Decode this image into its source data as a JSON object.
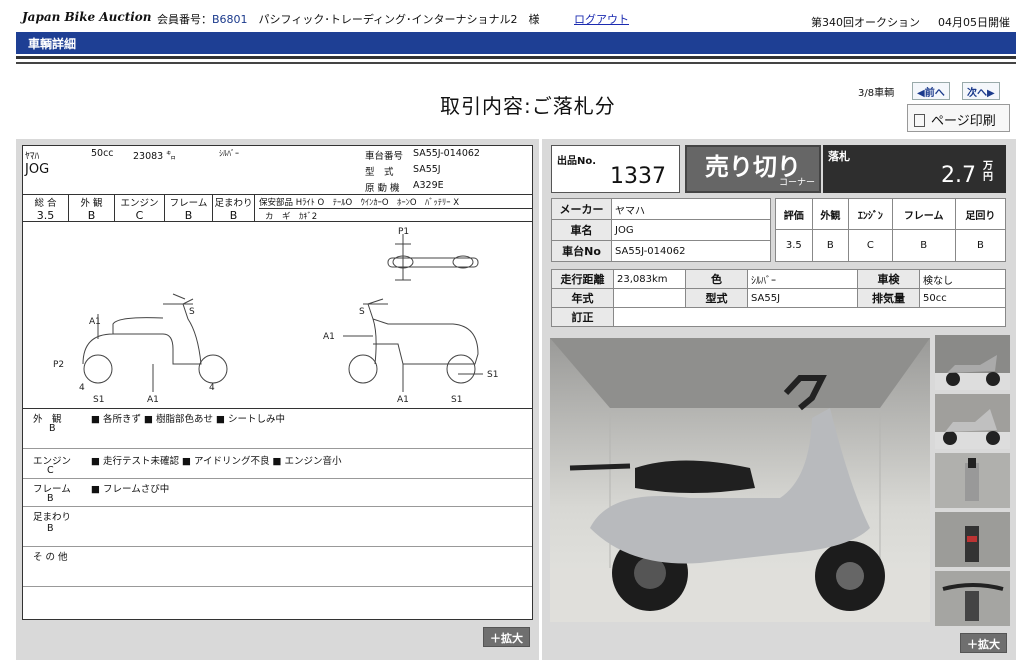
{
  "header": {
    "logo": "Japan Bike Auction",
    "member_label": "会員番号：",
    "member_no": "B6801",
    "member_name": "パシフィック･トレーディング･インターナショナル2　様",
    "logout": "ログアウト",
    "auction": "第340回オークション",
    "date": "04月05日開催"
  },
  "title_bar": "車輌詳細",
  "page_heading": "取引内容:ご落札分",
  "nav": {
    "count": "3/8車輌",
    "prev": "◀前へ",
    "next": "次へ▶",
    "print": "ページ印刷"
  },
  "sheet": {
    "maker": "ﾔﾏﾊ",
    "cc": "50cc",
    "km": "23083 ㌔",
    "color": "ｼﾙﾊﾞｰ",
    "model": "JOG",
    "frame_label": "車台番号",
    "frame_no": "SA55J-014062",
    "type_label": "型　式",
    "type": "SA55J",
    "engine_label": "原 動 機",
    "engine": "A329E",
    "grade_headers": [
      "総 合",
      "外 観",
      "エンジン",
      "フレーム",
      "足まわり"
    ],
    "grade_values": [
      "3.5",
      "B",
      "C",
      "B",
      "B"
    ],
    "parts_header": "保安部品 Hﾗｲﾄ O　ﾃｰﾙO　ｳｲﾝｶｰO　ﾎｰﾝO　ﾊﾞｯﾃﾘｰ X",
    "parts_key": "カ　ギ　ｶｷﾞ2",
    "diagram_labels": {
      "p1": "P1",
      "p2": "P2",
      "a1": "A1",
      "s": "S",
      "s1": "S1",
      "four": "4"
    },
    "remarks": [
      {
        "label": "外　観",
        "grade": "B",
        "text": "■ 各所きず ■ 樹脂部色あせ ■ シートしみ中"
      },
      {
        "label": "エンジン",
        "grade": "C",
        "text": "■ 走行テスト未確認 ■ アイドリング不良 ■ エンジン音小"
      },
      {
        "label": "フレーム",
        "grade": "B",
        "text": "■ フレームさび中"
      },
      {
        "label": "足まわり",
        "grade": "B",
        "text": ""
      },
      {
        "label": "そ の 他",
        "grade": "",
        "text": ""
      }
    ]
  },
  "zoom_label": "＋拡大",
  "lot": {
    "label": "出品No.",
    "number": "1337"
  },
  "soldout": {
    "text": "売り切り",
    "corner": "コーナー"
  },
  "price": {
    "label": "落札",
    "value": "2.7",
    "unit_top": "万",
    "unit_bottom": "円"
  },
  "info": {
    "maker_label": "メーカー",
    "maker": "ヤマハ",
    "name_label": "車名",
    "name": "JOG",
    "frame_label": "車台No",
    "frame": "SA55J-014062",
    "grade_headers": [
      "評価",
      "外観",
      "ｴﾝｼﾞﾝ",
      "フレーム",
      "足回り"
    ],
    "grade_values": [
      "3.5",
      "B",
      "C",
      "B",
      "B"
    ],
    "mileage_label": "走行距離",
    "mileage": "23,083km",
    "color_label": "色",
    "color": "ｼﾙﾊﾞｰ",
    "inspection_label": "車検",
    "inspection": "検なし",
    "year_label": "年式",
    "year": "",
    "model_label": "型式",
    "model": "SA55J",
    "displacement_label": "排気量",
    "displacement": "50cc",
    "correction_label": "訂正",
    "correction": ""
  },
  "colors": {
    "header_blue": "#1e3f94",
    "panel_gray": "#d9d9d9",
    "price_black": "#2e2e2e"
  }
}
